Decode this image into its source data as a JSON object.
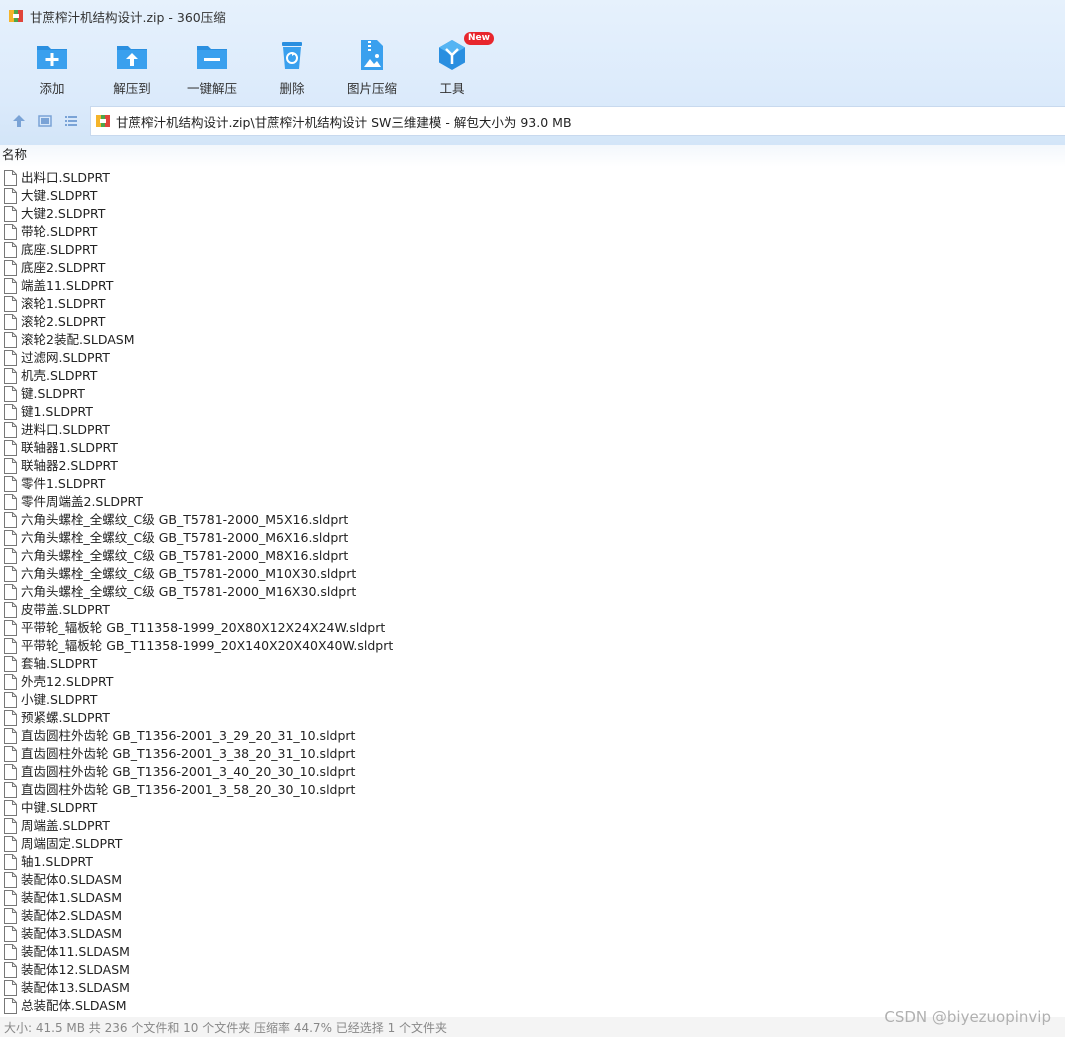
{
  "window": {
    "title": "甘蔗榨汁机结构设计.zip - 360压缩"
  },
  "toolbar": {
    "items": [
      {
        "label": "添加",
        "icon": "add-icon"
      },
      {
        "label": "解压到",
        "icon": "extract-to-icon"
      },
      {
        "label": "一键解压",
        "icon": "one-click-extract-icon"
      },
      {
        "label": "删除",
        "icon": "delete-icon"
      },
      {
        "label": "图片压缩",
        "icon": "image-compress-icon"
      },
      {
        "label": "工具",
        "icon": "tools-icon",
        "badge": "New"
      }
    ]
  },
  "address": {
    "path": "甘蔗榨汁机结构设计.zip\\甘蔗榨汁机结构设计 SW三维建模 - 解包大小为 93.0 MB"
  },
  "list": {
    "column_name": "名称",
    "files": [
      "出料口.SLDPRT",
      "大键.SLDPRT",
      "大键2.SLDPRT",
      "带轮.SLDPRT",
      "底座.SLDPRT",
      "底座2.SLDPRT",
      "端盖11.SLDPRT",
      "滚轮1.SLDPRT",
      "滚轮2.SLDPRT",
      "滚轮2装配.SLDASM",
      "过滤网.SLDPRT",
      "机壳.SLDPRT",
      "键.SLDPRT",
      "键1.SLDPRT",
      "进料口.SLDPRT",
      "联轴器1.SLDPRT",
      "联轴器2.SLDPRT",
      "零件1.SLDPRT",
      "零件周端盖2.SLDPRT",
      "六角头螺栓_全螺纹_C级 GB_T5781-2000_M5X16.sldprt",
      "六角头螺栓_全螺纹_C级 GB_T5781-2000_M6X16.sldprt",
      "六角头螺栓_全螺纹_C级 GB_T5781-2000_M8X16.sldprt",
      "六角头螺栓_全螺纹_C级 GB_T5781-2000_M10X30.sldprt",
      "六角头螺栓_全螺纹_C级 GB_T5781-2000_M16X30.sldprt",
      "皮带盖.SLDPRT",
      "平带轮_辐板轮 GB_T11358-1999_20X80X12X24X24W.sldprt",
      "平带轮_辐板轮 GB_T11358-1999_20X140X20X40X40W.sldprt",
      "套轴.SLDPRT",
      "外壳12.SLDPRT",
      "小键.SLDPRT",
      "预紧螺.SLDPRT",
      "直齿圆柱外齿轮 GB_T1356-2001_3_29_20_31_10.sldprt",
      "直齿圆柱外齿轮 GB_T1356-2001_3_38_20_31_10.sldprt",
      "直齿圆柱外齿轮 GB_T1356-2001_3_40_20_30_10.sldprt",
      "直齿圆柱外齿轮 GB_T1356-2001_3_58_20_30_10.sldprt",
      "中键.SLDPRT",
      "周端盖.SLDPRT",
      "周端固定.SLDPRT",
      "轴1.SLDPRT",
      "装配体0.SLDASM",
      "装配体1.SLDASM",
      "装配体2.SLDASM",
      "装配体3.SLDASM",
      "装配体11.SLDASM",
      "装配体12.SLDASM",
      "装配体13.SLDASM",
      "总装配体.SLDASM"
    ]
  },
  "status": {
    "text": "大小: 41.5 MB 共 236 个文件和 10 个文件夹 压缩率 44.7% 已经选择 1 个文件夹"
  },
  "watermark": "CSDN @biyezuopinvip",
  "colors": {
    "toolbar_bg": "#dbeafb",
    "icon_blue": "#2a8fe0",
    "badge_red": "#e8262d"
  }
}
